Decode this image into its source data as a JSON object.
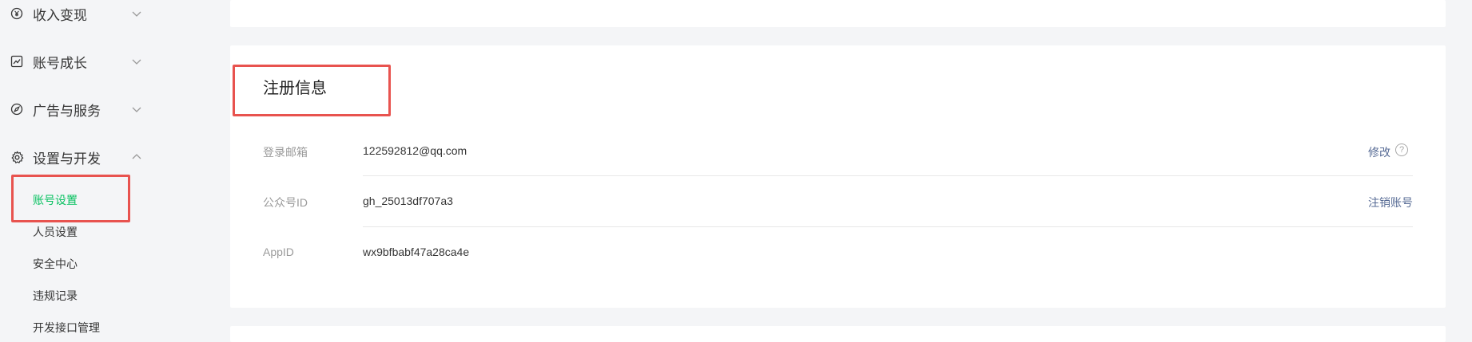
{
  "sidebar": {
    "groups": [
      {
        "label": "收入变现",
        "icon": "yen-circle-icon"
      },
      {
        "label": "账号成长",
        "icon": "growth-chart-icon"
      },
      {
        "label": "广告与服务",
        "icon": "compass-icon"
      },
      {
        "label": "设置与开发",
        "icon": "gear-icon"
      }
    ],
    "sub_items": [
      {
        "label": "账号设置",
        "active": true
      },
      {
        "label": "人员设置"
      },
      {
        "label": "安全中心"
      },
      {
        "label": "违规记录"
      },
      {
        "label": "开发接口管理"
      }
    ]
  },
  "registration": {
    "title": "注册信息",
    "rows": [
      {
        "label": "登录邮箱",
        "value": "122592812@qq.com",
        "action": "修改",
        "help": "?"
      },
      {
        "label": "公众号ID",
        "value": "gh_25013df707a3",
        "action": "注销账号"
      },
      {
        "label": "AppID",
        "value": "wx9bfbabf47a28ca4e"
      }
    ]
  },
  "colors": {
    "accent_active": "#07c160",
    "link": "#576b95",
    "highlight_box": "#e8534f"
  }
}
